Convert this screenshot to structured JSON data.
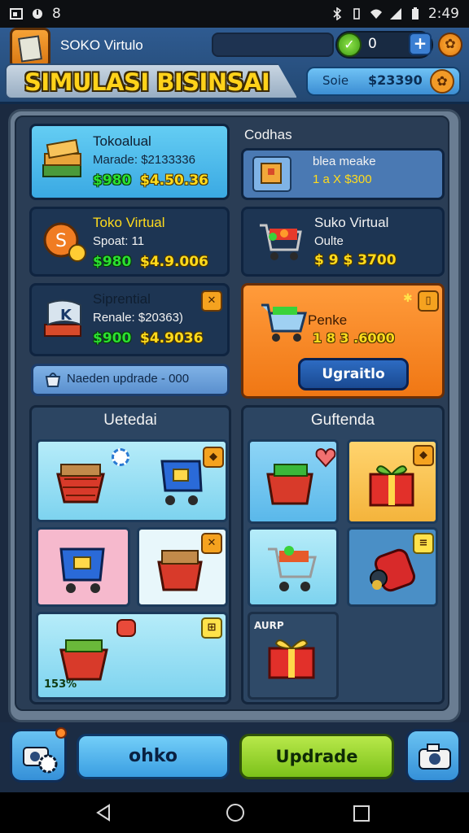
{
  "status_bar": {
    "left_digit": "8",
    "time": "2:49"
  },
  "header": {
    "app_name": "SOKO Virtulo",
    "coins": "0",
    "title": "SIMULASI BISINSAI",
    "sale_label": "Soie",
    "sale_value": "$23390"
  },
  "colors": {
    "accent_orange": "#f07714",
    "price_green": "#2be031",
    "price_yellow": "#ffdb1c",
    "upgrade_green": "#7cc21a"
  },
  "shops": [
    {
      "title": "Tokoalual",
      "sub": "Marade: $2133336",
      "price_green": "$980",
      "price_yellow": "$4.50.36"
    },
    {
      "title": "Toko Virtual",
      "sub": "Spoat: 11",
      "price_green": "$980",
      "price_yellow": "$4.9.006"
    },
    {
      "title": "Siprential",
      "sub": "Renale: $20363)",
      "price_green": "$900",
      "price_yellow": "$4.9036"
    }
  ],
  "right_cards": {
    "section_label": "Codhas",
    "card1": {
      "title": "blea meake",
      "price": "1 a X $300"
    },
    "card2": {
      "title": "Suko Virtual",
      "sub": "Oulte",
      "price": "$ 9 $ 3700"
    },
    "card3": {
      "title": "Penke",
      "price": "1 8 3 .6000",
      "button": "Ugraitlo"
    }
  },
  "notice": "Naeden updrade - 000",
  "inventory_left": {
    "title": "Uetedai",
    "percent": "153%"
  },
  "inventory_right": {
    "title": "Guftenda",
    "aura": "AURP"
  },
  "bottom": {
    "shop_label": "ohko",
    "upgrade_label": "Updrade"
  }
}
